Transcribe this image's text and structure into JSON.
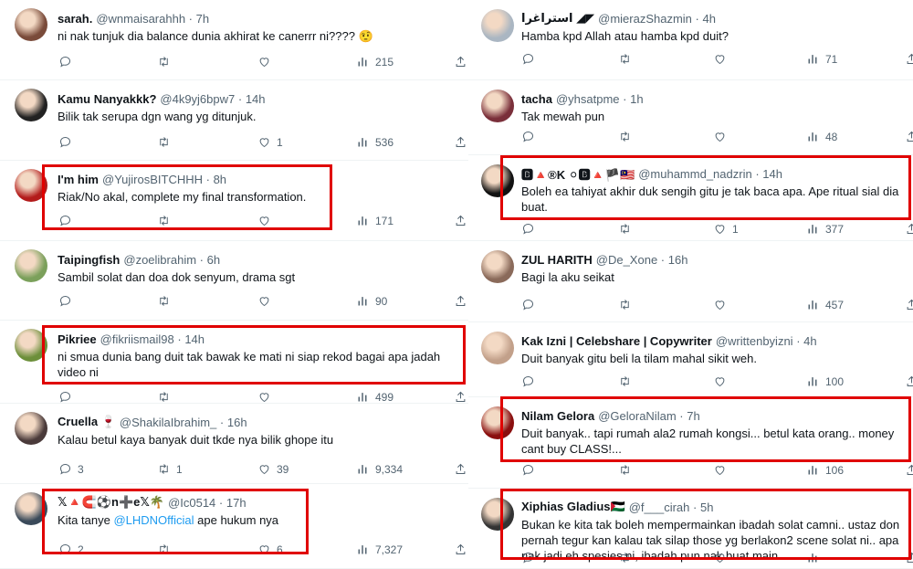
{
  "left": [
    {
      "name": "sarah.",
      "handle": "@wnmaisarahhh",
      "time": "7h",
      "text": "ni nak tunjuk dia balance dunia akhirat ke canerrr ni???? 🤨",
      "replies": "",
      "retweets": "",
      "likes": "",
      "views": "215"
    },
    {
      "name": "Kamu Nanyakkk?",
      "handle": "@4k9yj6bpw7",
      "time": "14h",
      "text": "Bilik tak serupa dgn wang yg ditunjuk.",
      "replies": "",
      "retweets": "",
      "likes": "1",
      "views": "536"
    },
    {
      "name": "I'm him",
      "handle": "@YujirosBITCHHH",
      "time": "8h",
      "text": "Riak/No akal, complete my final transformation.",
      "replies": "",
      "retweets": "",
      "likes": "",
      "views": "171"
    },
    {
      "name": "Taipingfish",
      "handle": "@zoelibrahim",
      "time": "6h",
      "text": "Sambil solat dan doa dok senyum, drama sgt",
      "replies": "",
      "retweets": "",
      "likes": "",
      "views": "90"
    },
    {
      "name": "Pikriee",
      "handle": "@fikriismail98",
      "time": "14h",
      "text": "ni smua dunia bang duit tak bawak ke mati ni siap rekod bagai apa jadah video ni",
      "replies": "",
      "retweets": "",
      "likes": "",
      "views": "499"
    },
    {
      "name": "Cruella 🍷",
      "handle": "@ShakilaIbrahim_",
      "time": "16h",
      "text": "Kalau betul kaya banyak duit tkde nya bilik ghope itu",
      "replies": "3",
      "retweets": "1",
      "likes": "39",
      "views": "9,334"
    },
    {
      "name": "𝕏🔺🧲⚽️n➕e𝕏🌴",
      "handle": "@Ic0514",
      "time": "17h",
      "text_before": "Kita tanye ",
      "mention": "@LHDNOfficial",
      "text_after": " ape hukum nya",
      "replies": "2",
      "retweets": "",
      "likes": "6",
      "views": "7,327"
    }
  ],
  "right": [
    {
      "name": "استراغرا ◢◤",
      "handle": "@mierazShazmin",
      "time": "4h",
      "text": "Hamba kpd Allah atau hamba kpd duit?",
      "replies": "",
      "retweets": "",
      "likes": "",
      "views": "71"
    },
    {
      "name": "tacha",
      "handle": "@yhsatpme",
      "time": "1h",
      "text": "Tak mewah pun",
      "replies": "",
      "retweets": "",
      "likes": "",
      "views": "48"
    },
    {
      "name": "🅱🔺®K ⚪🅱🔺🏴🇲🇾",
      "handle": "@muhammd_nadzrin",
      "time": "14h",
      "text": "Boleh ea tahiyat akhir duk sengih gitu je tak baca apa. Ape ritual sial dia buat.",
      "replies": "",
      "retweets": "",
      "likes": "1",
      "views": "377"
    },
    {
      "name": "ZUL HARITH",
      "handle": "@De_Xone",
      "time": "16h",
      "text": "Bagi la aku seikat",
      "replies": "",
      "retweets": "",
      "likes": "",
      "views": "457"
    },
    {
      "name": "Kak Izni | Celebshare | Copywriter",
      "handle": "@writtenbyizni",
      "time": "4h",
      "text": "Duit banyak gitu beli la tilam mahal sikit weh.",
      "replies": "",
      "retweets": "",
      "likes": "",
      "views": "100"
    },
    {
      "name": "Nilam Gelora",
      "handle": "@GeloraNilam",
      "time": "7h",
      "text": "Duit banyak.. tapi rumah ala2 rumah kongsi... betul kata orang.. money cant buy CLASS!...",
      "replies": "",
      "retweets": "",
      "likes": "",
      "views": "106"
    },
    {
      "name": "Xiphias Gladius🇵🇸",
      "handle": "@f___cirah",
      "time": "5h",
      "text": "Bukan ke kita tak boleh mempermainkan ibadah solat camni.. ustaz don pernah tegur kan kalau tak silap those yg berlakon2 scene solat ni.. apa nak jadi eh spesies ni, ibadah pun nak buat main",
      "replies": "",
      "retweets": "",
      "likes": "",
      "views": ""
    }
  ],
  "icons": [
    "reply-icon",
    "retweet-icon",
    "like-icon",
    "views-icon",
    "share-icon",
    "more-icon"
  ],
  "colors": {
    "highlight": "#e00000",
    "mention": "#1d9bf0",
    "muted": "#536471",
    "text": "#0f1419"
  }
}
